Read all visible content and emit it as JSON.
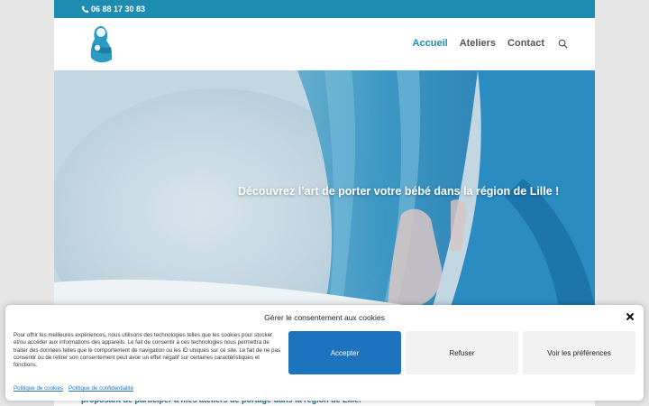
{
  "topbar": {
    "phone": "06 88 17 30 83"
  },
  "nav": {
    "items": [
      "Accueil",
      "Ateliers",
      "Contact"
    ]
  },
  "hero": {
    "headline": "Découvrez l’art de porter votre bébé dans la région de Lille !"
  },
  "content": {
    "partial_text": "proposant de participer à mes ateliers de portage dans la région de Lille."
  },
  "consent": {
    "title": "Gérer le consentement aux cookies",
    "body": "Pour offrir les meilleures expériences, nous utilisons des technologies telles que les cookies pour stocker et/ou accéder aux informations des appareils. Le fait de consentir à ces technologies nous permettra de traiter des données telles que le comportement de navigation ou les ID uniques sur ce site. Le fait de ne pas consentir ou de retirer son consentement peut avoir un effet négatif sur certaines caractéristiques et fonctions.",
    "accept": "Accepter",
    "refuse": "Refuser",
    "prefs": "Voir les préférences",
    "links": [
      "Politique de cookies",
      "Politique de confidentialité"
    ]
  },
  "colors": {
    "brand": "#1e8db2",
    "accept": "#1e73be"
  }
}
